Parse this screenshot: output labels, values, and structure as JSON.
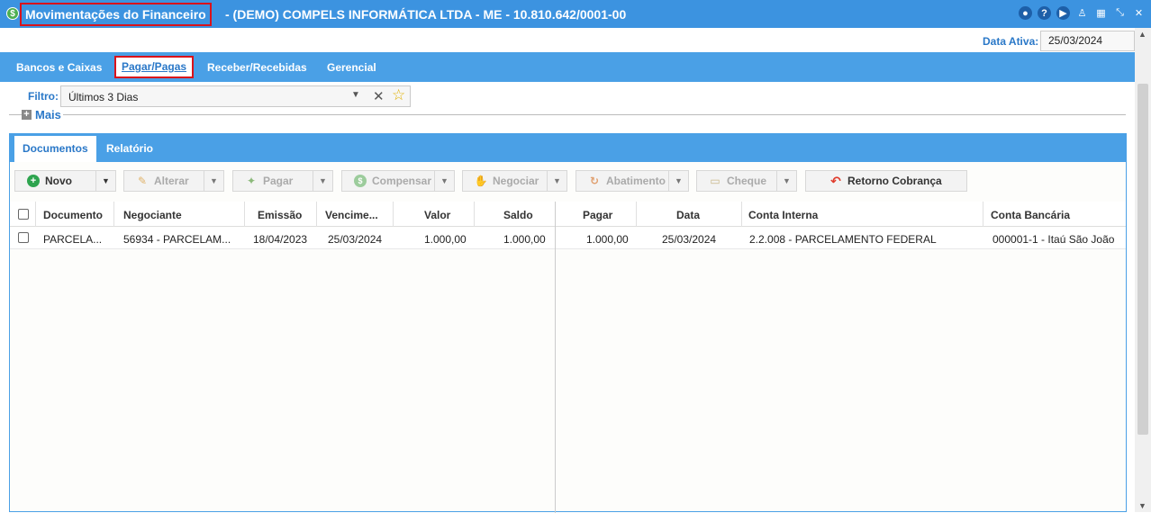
{
  "window": {
    "title_main": "Movimentações do Financeiro",
    "title_rest": "- (DEMO) COMPELS INFORMÁTICA LTDA - ME - 10.810.642/0001-00",
    "app_icon": "$",
    "icons": [
      "chat-icon",
      "help-icon",
      "play-icon",
      "user-icon",
      "calendar-icon",
      "fullscreen-icon",
      "close-icon"
    ]
  },
  "data_ativa": {
    "label": "Data Ativa:",
    "value": "25/03/2024"
  },
  "main_tabs": [
    {
      "label": "Bancos e Caixas"
    },
    {
      "label": "Pagar/Pagas"
    },
    {
      "label": "Receber/Recebidas"
    },
    {
      "label": "Gerencial"
    }
  ],
  "filter": {
    "label": "Filtro:",
    "value": "Últimos 3 Dias"
  },
  "mais": {
    "label": "Mais"
  },
  "sub_tabs": [
    {
      "label": "Documentos"
    },
    {
      "label": "Relatório"
    }
  ],
  "toolbar": {
    "novo": "Novo",
    "alterar": "Alterar",
    "pagar": "Pagar",
    "compensar": "Compensar",
    "negociar": "Negociar",
    "abatimento": "Abatimento",
    "cheque": "Cheque",
    "retorno": "Retorno Cobrança"
  },
  "grid": {
    "columns": [
      "Documento",
      "Negociante",
      "Emissão",
      "Vencime...",
      "Valor",
      "Saldo",
      "Pagar",
      "Data",
      "Conta Interna",
      "Conta Bancária"
    ],
    "rows": [
      {
        "documento": "PARCELA...",
        "negociante": "56934 - PARCELAM...",
        "emissao": "18/04/2023",
        "vencimento": "25/03/2024",
        "valor": "1.000,00",
        "saldo": "1.000,00",
        "pagar": "1.000,00",
        "data": "25/03/2024",
        "conta_interna": "2.2.008 - PARCELAMENTO FEDERAL",
        "conta_bancaria": "000001-1 - Itaú São João"
      }
    ]
  }
}
